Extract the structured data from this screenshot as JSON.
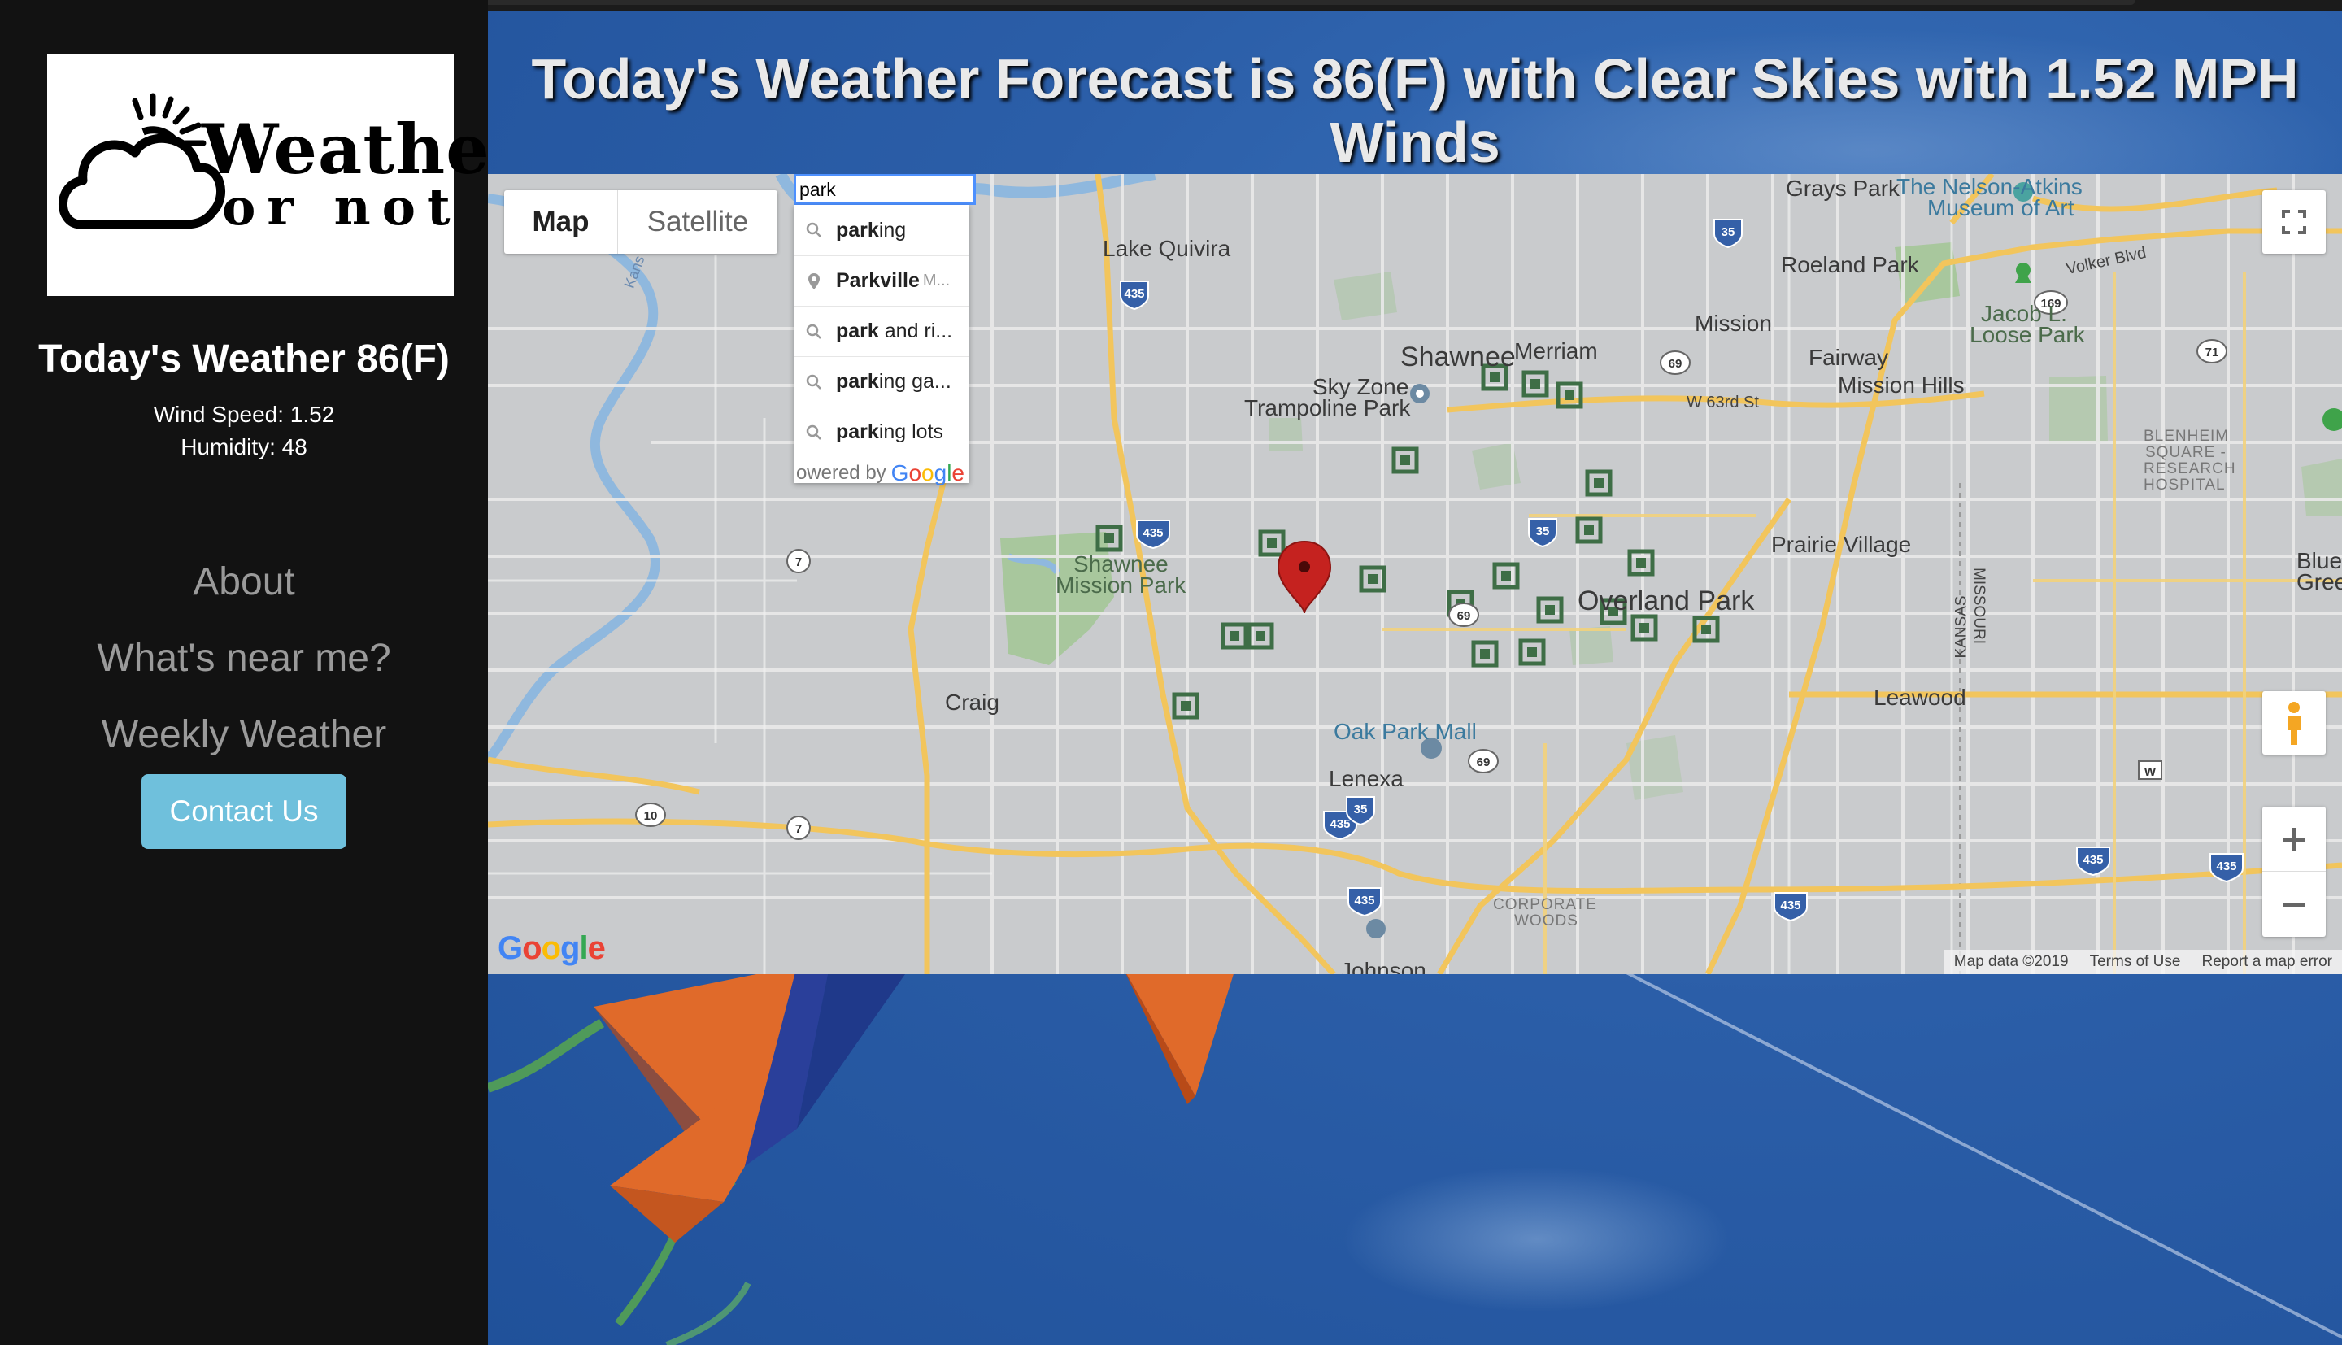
{
  "sidebar": {
    "logo": {
      "word1": "Weather",
      "word2": "or not"
    },
    "today_title": "Today's Weather 86(F)",
    "wind": "Wind Speed: 1.52",
    "humidity": "Humidity: 48",
    "nav": {
      "about": "About",
      "near": "What's near me?",
      "weekly": "Weekly Weather"
    },
    "contact": "Contact Us"
  },
  "main": {
    "headline": "Today's Weather Forecast is 86(F) with Clear Skies with 1.52 MPH Winds"
  },
  "map": {
    "type_controls": {
      "map": "Map",
      "satellite": "Satellite",
      "selected": "Map"
    },
    "search": {
      "value": "park"
    },
    "autocomplete": [
      {
        "icon": "search-icon",
        "bold": "park",
        "rest": "ing",
        "extra": ""
      },
      {
        "icon": "pin-icon",
        "bold": "Park",
        "rest": "ville",
        "extra": "M..."
      },
      {
        "icon": "search-icon",
        "bold": "park",
        "rest": " and ri...",
        "extra": ""
      },
      {
        "icon": "search-icon",
        "bold": "park",
        "rest": "ing ga...",
        "extra": ""
      },
      {
        "icon": "search-icon",
        "bold": "park",
        "rest": "ing lots",
        "extra": ""
      }
    ],
    "powered_by": "owered by",
    "powered_google": "Google",
    "labels": {
      "grays_park": "Grays Park",
      "nelson_1": "The Nelson-Atkins",
      "nelson_2": "Museum of Art",
      "lake_quivira": "Lake Quivira",
      "roeland_park": "Roeland Park",
      "volker": "Volker Blvd",
      "mission": "Mission",
      "jacob_1": "Jacob L.",
      "jacob_2": "Loose Park",
      "shawnee": "Shawnee",
      "merriam": "Merriam",
      "fairway": "Fairway",
      "mission_hills": "Mission Hills",
      "sky_zone_1": "Sky Zone",
      "sky_zone_2": "Trampoline Park",
      "w63": "W 63rd St",
      "blenheim_1": "BLENHEIM",
      "blenheim_2": "SQUARE -",
      "blenheim_3": "RESEARCH",
      "blenheim_4": "HOSPITAL",
      "prairie_village": "Prairie Village",
      "shawnee_mission_1": "Shawnee",
      "shawnee_mission_2": "Mission Park",
      "overland_park": "Overland Park",
      "blue_1": "Blue",
      "blue_2": "Gree",
      "craig": "Craig",
      "leawood": "Leawood",
      "oak_park_mall": "Oak Park Mall",
      "lenexa": "Lenexa",
      "corporate_1": "CORPORATE",
      "corporate_2": "WOODS",
      "johnson": "Johnson",
      "kansas_1": "KANSAS",
      "missouri": "MISSOURI",
      "kansas_river": "Kans"
    },
    "shields": {
      "i35": "35",
      "i435": "435",
      "us69": "69",
      "us169": "169",
      "us71": "71",
      "k7": "7",
      "k10": "10",
      "w": "W"
    },
    "attribution": {
      "data": "Map data ©2019",
      "terms": "Terms of Use",
      "report": "Report a map error"
    },
    "google_logo": "Google"
  },
  "colors": {
    "sidebar_bg": "#121212",
    "header_bg": "#2d63ad",
    "contact_btn": "#6fc0dc",
    "nav_text": "#9a9a9a",
    "map_bg": "#c9cbcd",
    "road_yellow": "#f2c55c",
    "park_green": "#9cc68d",
    "marker_red": "#c5221f",
    "place_marker": "#3e6e46"
  }
}
